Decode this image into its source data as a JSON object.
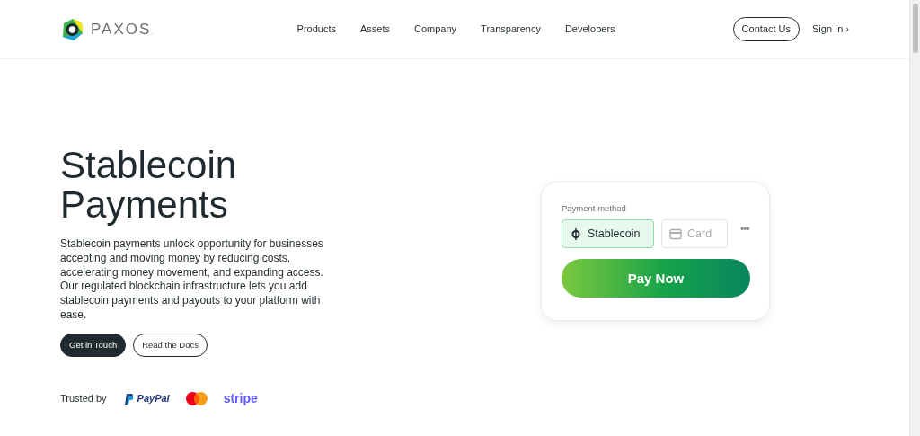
{
  "brand": {
    "name": "PAXOS",
    "mark": "."
  },
  "nav": [
    {
      "label": "Products"
    },
    {
      "label": "Assets"
    },
    {
      "label": "Company"
    },
    {
      "label": "Transparency"
    },
    {
      "label": "Developers"
    }
  ],
  "contact_button": "Contact Us",
  "sign_in": {
    "label": "Sign In",
    "arrow": "›"
  },
  "hero": {
    "title": "Stablecoin Payments",
    "text": "Stablecoin payments unlock opportunity for businesses accepting and moving money by reducing costs, accelerating money movement, and expanding access. Our regulated blockchain infrastructure lets you add stablecoin payments and payouts to your platform with ease.",
    "buttons": [
      {
        "label": "Get in Touch",
        "kind": "primary"
      },
      {
        "label": "Read the Docs",
        "kind": "outline"
      }
    ]
  },
  "trusted": {
    "label": "Trusted by",
    "logos": [
      {
        "kind": "paypal",
        "text": "PayPal"
      },
      {
        "kind": "mastercard"
      },
      {
        "kind": "stripe",
        "text": "stripe"
      }
    ]
  },
  "payment_card": {
    "label": "Payment method",
    "options": [
      {
        "label": "Stablecoin",
        "kind": "coin",
        "selected": true
      },
      {
        "label": "Card",
        "kind": "card",
        "selected": false
      }
    ],
    "more": "•••",
    "pay_button": "Pay Now"
  }
}
